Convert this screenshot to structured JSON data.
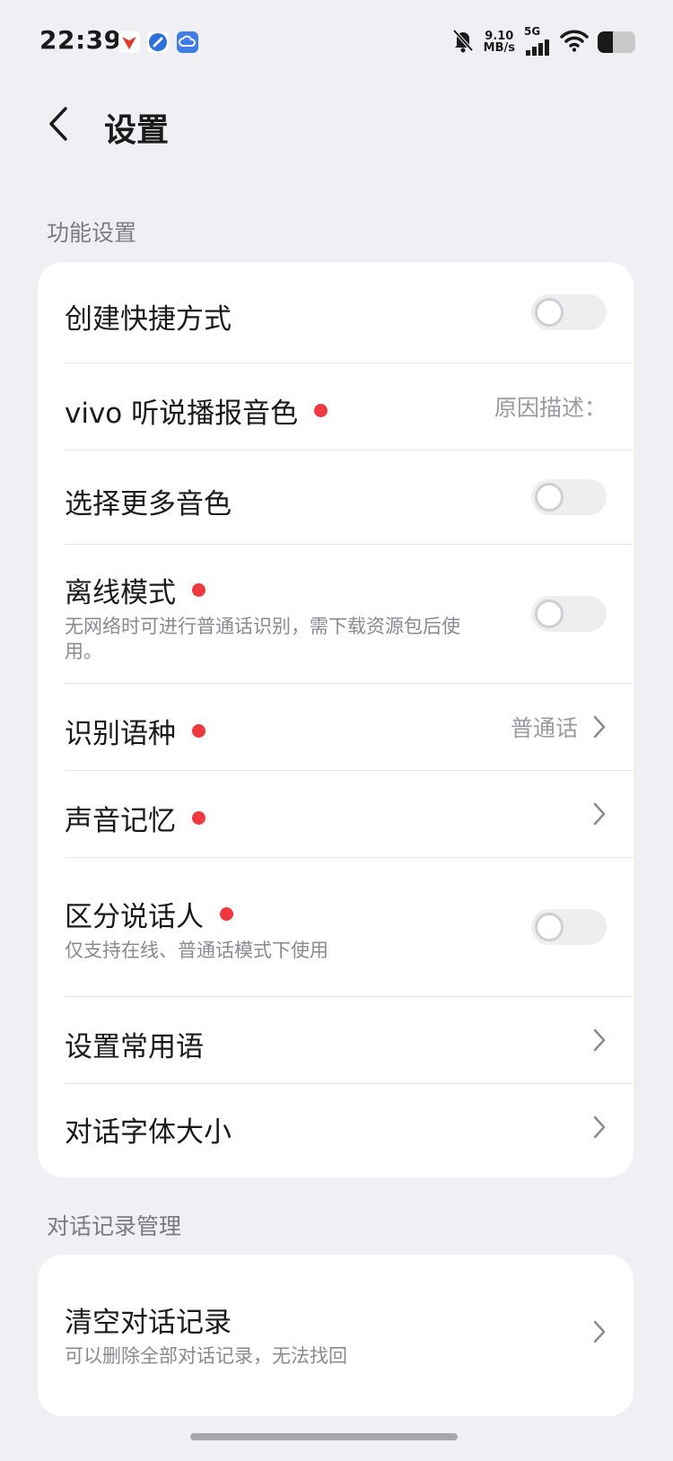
{
  "status_bar": {
    "time": "22:39",
    "net_speed_value": "9.10",
    "net_speed_unit": "MB/s",
    "signal_label": "5G",
    "battery_level": 0.4,
    "icons": [
      "silent-bell-icon",
      "signal-bars-icon",
      "wifi-icon",
      "battery-icon"
    ]
  },
  "header": {
    "back_icon": "chevron-left-icon",
    "title": "设置"
  },
  "sections": [
    {
      "title": "功能设置",
      "items": [
        {
          "label": "创建快捷方式",
          "control": "toggle",
          "on": false
        },
        {
          "label": "vivo 听说播报音色",
          "dot": true,
          "value": "原因描述："
        },
        {
          "label": "选择更多音色",
          "control": "toggle",
          "on": false
        },
        {
          "label": "离线模式",
          "dot": true,
          "subtitle": "无网络时可进行普通话识别，需下载资源包后使用。",
          "control": "toggle",
          "on": false
        },
        {
          "label": "识别语种",
          "dot": true,
          "value": "普通话",
          "control": "chevron"
        },
        {
          "label": "声音记忆",
          "dot": true,
          "control": "chevron"
        },
        {
          "label": "区分说话人",
          "dot": true,
          "subtitle": "仅支持在线、普通话模式下使用",
          "control": "toggle",
          "on": false
        },
        {
          "label": "设置常用语",
          "control": "chevron"
        },
        {
          "label": "对话字体大小",
          "control": "chevron"
        }
      ]
    },
    {
      "title": "对话记录管理",
      "items": [
        {
          "label": "清空对话记录",
          "subtitle": "可以删除全部对话记录，无法找回",
          "control": "chevron"
        }
      ]
    }
  ],
  "colors": {
    "background": "#f0f0f4",
    "card": "#ffffff",
    "dot": "#ee3a3f",
    "secondary_text": "#8a8a90"
  }
}
